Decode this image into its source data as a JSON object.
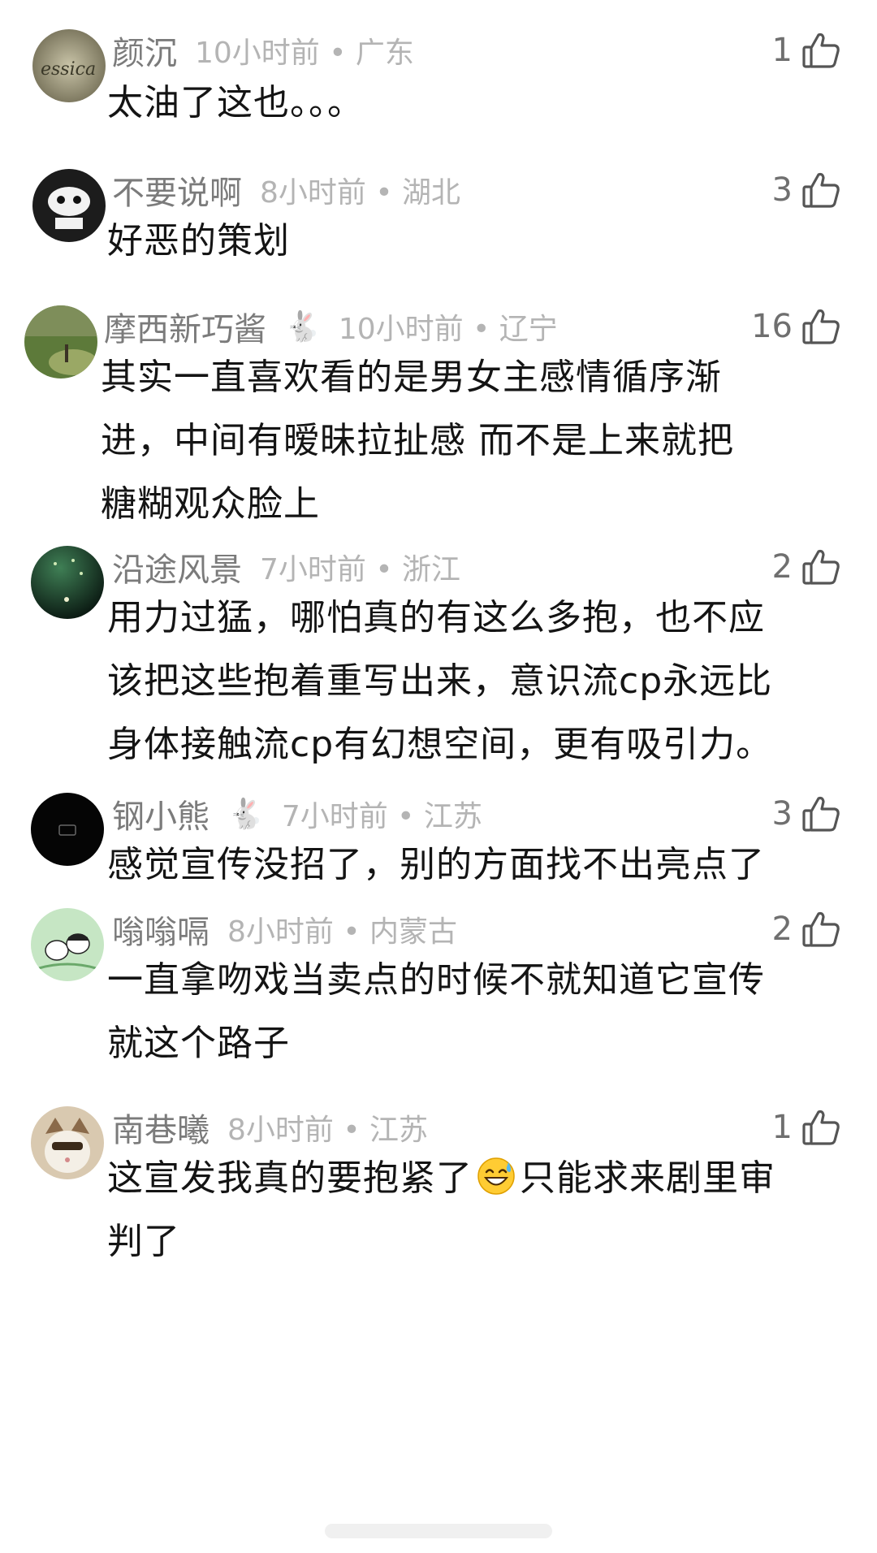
{
  "comments": [
    {
      "user": "颜沉",
      "badge": "",
      "time_loc": "10小时前 • 广东",
      "likes": "1",
      "lines": [
        "太油了这也。。。"
      ]
    },
    {
      "user": "不要说啊",
      "badge": "",
      "time_loc": "8小时前 • 湖北",
      "likes": "3",
      "lines": [
        "好恶的策划"
      ]
    },
    {
      "user": "摩西新巧酱",
      "badge": "🐇",
      "time_loc": "10小时前 • 辽宁",
      "likes": "16",
      "lines": [
        "其实一直喜欢看的是男女主感情循序渐",
        "进，中间有暧昧拉扯感 而不是上来就把",
        "糖糊观众脸上"
      ]
    },
    {
      "user": "沿途风景",
      "badge": "",
      "time_loc": "7小时前 • 浙江",
      "likes": "2",
      "lines": [
        "用力过猛，哪怕真的有这么多抱，也不应",
        "该把这些抱着重写出来，意识流cp永远比",
        "身体接触流cp有幻想空间，更有吸引力。"
      ]
    },
    {
      "user": "钢小熊",
      "badge": "🐇",
      "time_loc": "7小时前 • 江苏",
      "likes": "3",
      "lines": [
        "感觉宣传没招了，别的方面找不出亮点了"
      ]
    },
    {
      "user": "嗡嗡嗝",
      "badge": "",
      "time_loc": "8小时前 • 内蒙古",
      "likes": "2",
      "lines": [
        "一直拿吻戏当卖点的时候不就知道它宣传",
        "就这个路子"
      ]
    },
    {
      "user": "南巷曦",
      "badge": "",
      "time_loc": "8小时前 • 江苏",
      "likes": "1",
      "lines_rich": {
        "before": "这宣发我真的要抱紧了",
        "emoji": "sweat-smile-emoji",
        "after": "只能求来剧里审",
        "line2": "判了"
      }
    }
  ],
  "icons": {
    "like": "thumbs-up-outline-icon",
    "badge": "rabbit-icon"
  },
  "colors": {
    "username": "#7b7b7b",
    "meta": "#b4b4b4",
    "body_text": "#141414",
    "like_icon": "#555555"
  }
}
